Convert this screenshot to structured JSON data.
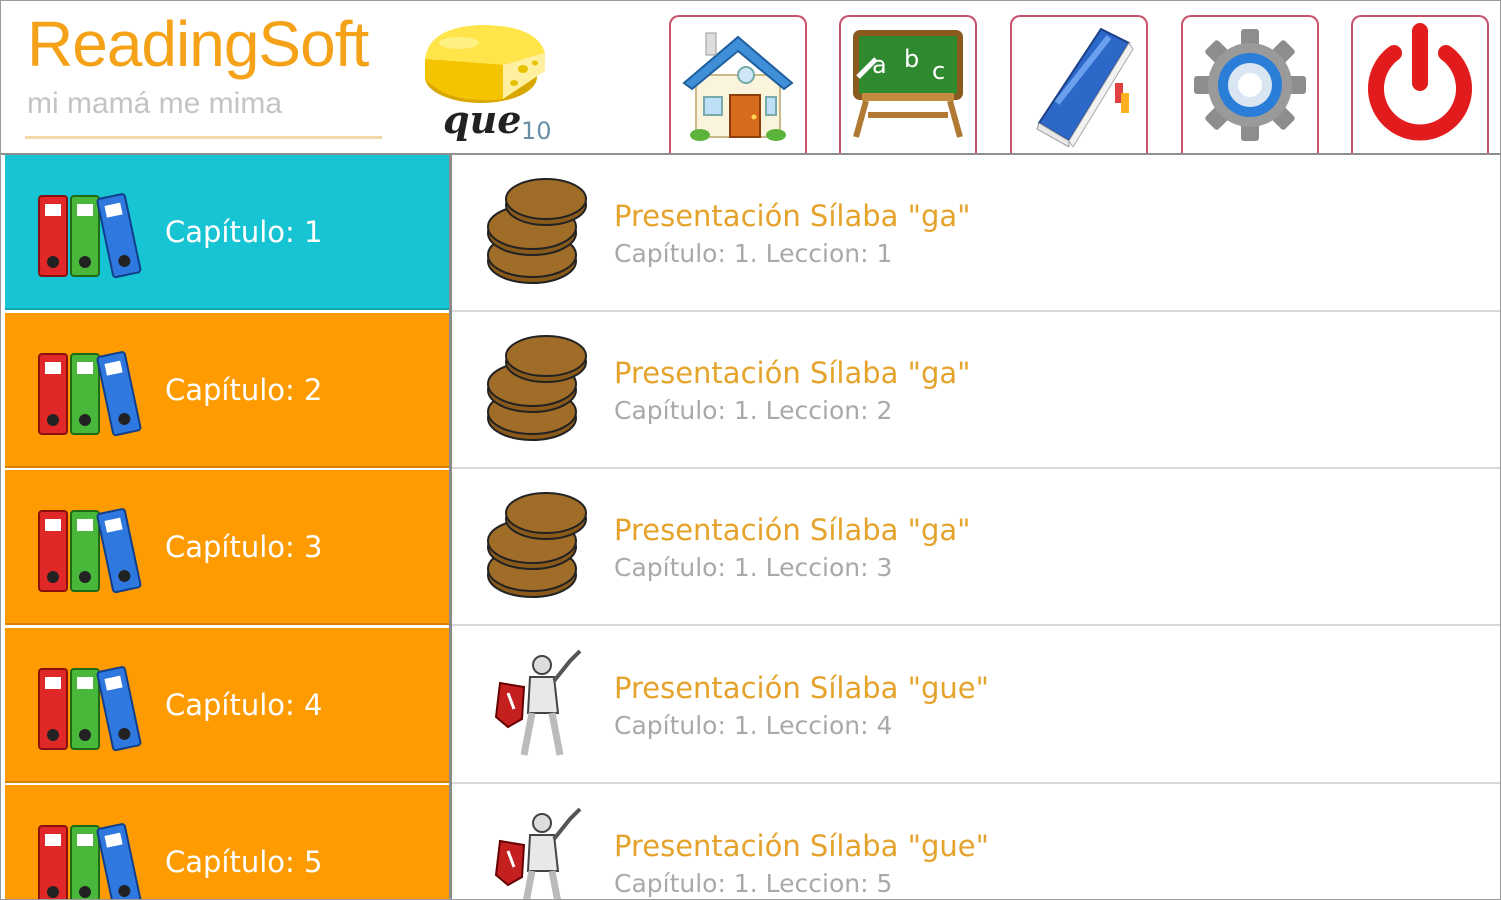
{
  "app": {
    "title": "ReadingSoft",
    "subtitle": "mi mamá me mima",
    "logo_word": "que",
    "logo_number": "10"
  },
  "toolbar": [
    {
      "name": "home",
      "icon": "house-icon"
    },
    {
      "name": "alphabet",
      "icon": "abc-chalkboard-icon"
    },
    {
      "name": "book",
      "icon": "book-icon"
    },
    {
      "name": "settings",
      "icon": "gear-icon"
    },
    {
      "name": "power",
      "icon": "power-icon"
    }
  ],
  "chapters": [
    {
      "label": "Capítulo: 1",
      "active": true
    },
    {
      "label": "Capítulo: 2",
      "active": false
    },
    {
      "label": "Capítulo: 3",
      "active": false
    },
    {
      "label": "Capítulo: 4",
      "active": false
    },
    {
      "label": "Capítulo: 5",
      "active": false
    }
  ],
  "lessons": [
    {
      "title": "Presentación Sílaba \"ga\"",
      "subtitle": "Capítulo: 1. Leccion: 1",
      "icon": "cookies-icon"
    },
    {
      "title": "Presentación Sílaba \"ga\"",
      "subtitle": "Capítulo: 1. Leccion: 2",
      "icon": "cookies-icon"
    },
    {
      "title": "Presentación Sílaba \"ga\"",
      "subtitle": "Capítulo: 1. Leccion: 3",
      "icon": "cookies-icon"
    },
    {
      "title": "Presentación Sílaba \"gue\"",
      "subtitle": "Capítulo: 1. Leccion: 4",
      "icon": "knight-icon"
    },
    {
      "title": "Presentación Sílaba \"gue\"",
      "subtitle": "Capítulo: 1. Leccion: 5",
      "icon": "knight-icon"
    }
  ],
  "colors": {
    "brand_orange": "#f5a218",
    "chapter_orange": "#fe9b00",
    "chapter_active": "#16c4d3",
    "lesson_title": "#e5a32c",
    "lesson_sub": "#a9a9a9"
  }
}
